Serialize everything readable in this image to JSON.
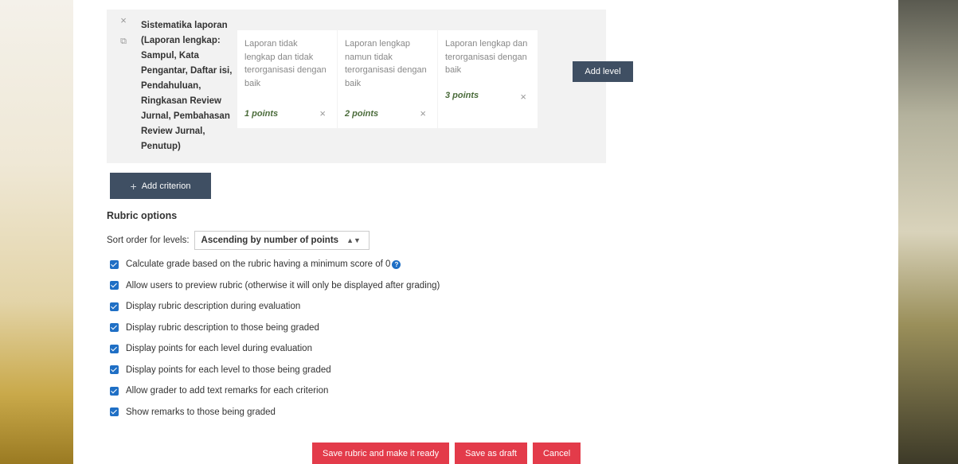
{
  "criterion": {
    "description": "Sistematika laporan (Laporan lengkap: Sampul, Kata Pengantar, Daftar isi, Pendahuluan, Ringkasan Review Jurnal, Pembahasan Review Jurnal, Penutup)",
    "levels": [
      {
        "definition": "Laporan tidak lengkap dan tidak terorganisasi dengan baik",
        "points": "1 points"
      },
      {
        "definition": "Laporan lengkap namun tidak terorganisasi dengan baik",
        "points": "2 points"
      },
      {
        "definition": "Laporan lengkap dan terorganisasi dengan baik",
        "points": "3 points"
      }
    ],
    "add_level_label": "Add level",
    "delete_icon": "×"
  },
  "add_criterion_label": "Add criterion",
  "rubric_options": {
    "title": "Rubric options",
    "sort_label": "Sort order for levels:",
    "sort_value": "Ascending by number of points",
    "options": [
      "Calculate grade based on the rubric having a minimum score of 0",
      "Allow users to preview rubric (otherwise it will only be displayed after grading)",
      "Display rubric description during evaluation",
      "Display rubric description to those being graded",
      "Display points for each level during evaluation",
      "Display points for each level to those being graded",
      "Allow grader to add text remarks for each criterion",
      "Show remarks to those being graded"
    ],
    "help_icon": "?"
  },
  "actions": {
    "save_ready": "Save rubric and make it ready",
    "save_draft": "Save as draft",
    "cancel": "Cancel"
  },
  "colors": {
    "dark_button": "#3f4f63",
    "red_button": "#e33b4a",
    "checkbox": "#1f6fc5",
    "points_text": "#4a6b3a"
  }
}
